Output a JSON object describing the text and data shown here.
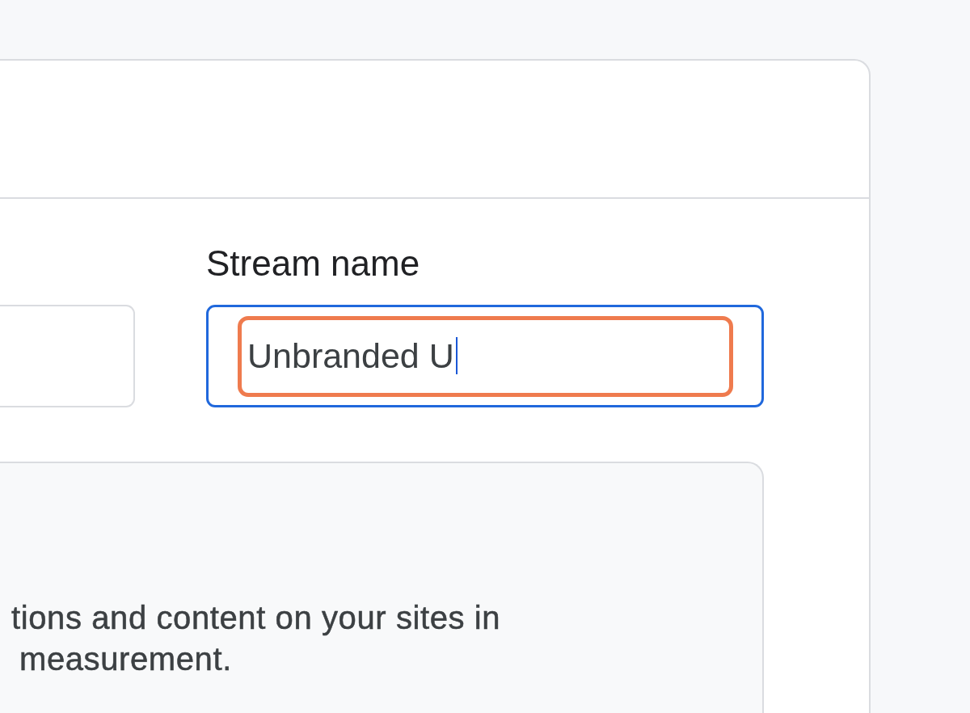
{
  "fields": [
    {
      "focused": false,
      "highlighted": false
    },
    {
      "label": "Stream name",
      "value": "Unbranded U",
      "focused": true,
      "highlighted": true
    }
  ],
  "info_box": {
    "text_lines": [
      "tions and content on your sites in",
      "measurement."
    ]
  }
}
